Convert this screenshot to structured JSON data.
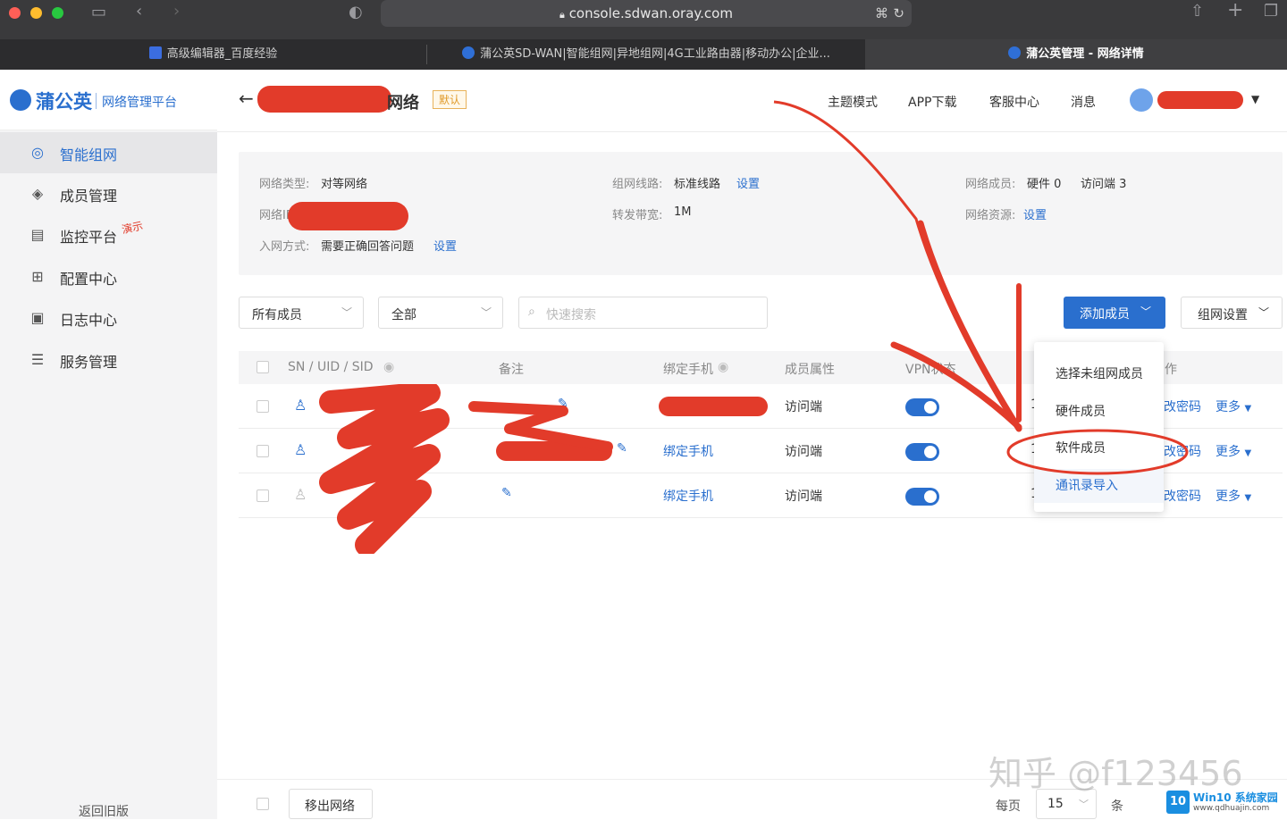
{
  "browser": {
    "url": "console.sdwan.oray.com",
    "tabs": [
      {
        "label": "高级编辑器_百度经验"
      },
      {
        "label": "蒲公英SD-WAN|智能组网|异地组网|4G工业路由器|移动办公|企业..."
      },
      {
        "label": "蒲公英管理 - 网络详情"
      }
    ]
  },
  "sidebar": {
    "logo_name": "蒲公英",
    "logo_sub": "网络管理平台",
    "items": [
      {
        "label": "智能组网",
        "icon": "network-icon"
      },
      {
        "label": "成员管理",
        "icon": "layers-icon"
      },
      {
        "label": "监控平台",
        "icon": "monitor-icon",
        "badge": "演示"
      },
      {
        "label": "配置中心",
        "icon": "grid-icon"
      },
      {
        "label": "日志中心",
        "icon": "clipboard-icon"
      },
      {
        "label": "服务管理",
        "icon": "document-icon"
      }
    ],
    "back_old": "返回旧版"
  },
  "header": {
    "title_suffix": "网络",
    "default_badge": "默认",
    "links": [
      "主题模式",
      "APP下载",
      "客服中心",
      "消息"
    ]
  },
  "info": {
    "type_label": "网络类型:",
    "type_value": "对等网络",
    "id_label": "网络ID",
    "join_label": "入网方式:",
    "join_value": "需要正确回答问题",
    "join_action": "设置",
    "line_label": "组网线路:",
    "line_value": "标准线路",
    "line_action": "设置",
    "bw_label": "转发带宽:",
    "bw_value": "1M",
    "members_label": "网络成员:",
    "members_hw": "硬件 0",
    "members_access": "访问端 3",
    "res_label": "网络资源:",
    "res_action": "设置"
  },
  "filters": {
    "member_select": "所有成员",
    "status_select": "全部",
    "search_placeholder": "快速搜索",
    "add_button": "添加成员",
    "settings_button": "组网设置"
  },
  "table": {
    "headers": [
      "SN / UID / SID",
      "备注",
      "绑定手机",
      "成员属性",
      "VPN状态",
      "作"
    ],
    "rows": [
      {
        "phone": "",
        "attr": "访问端",
        "col_i": "1",
        "action_pwd": "改密码",
        "action_more": "更多"
      },
      {
        "phone": "绑定手机",
        "attr": "访问端",
        "col_i": "1",
        "action_pwd": "改密码",
        "action_more": "更多"
      },
      {
        "phone": "绑定手机",
        "attr": "访问端",
        "col_i": "1",
        "action_pwd": "改密码",
        "action_more": "更多"
      }
    ]
  },
  "dropdown": {
    "items": [
      "选择未组网成员",
      "硬件成员",
      "软件成员",
      "通讯录导入"
    ]
  },
  "footer": {
    "remove_button": "移出网络",
    "per_page_label": "每页",
    "per_page_value": "15",
    "unit": "条"
  },
  "watermark": {
    "text": "知乎 @f123456",
    "site_badge": "Win10 系统家园",
    "site_url": "www.qdhuajin.com"
  },
  "colors": {
    "accent": "#2a6fce",
    "annotation": "#e23b2a"
  }
}
